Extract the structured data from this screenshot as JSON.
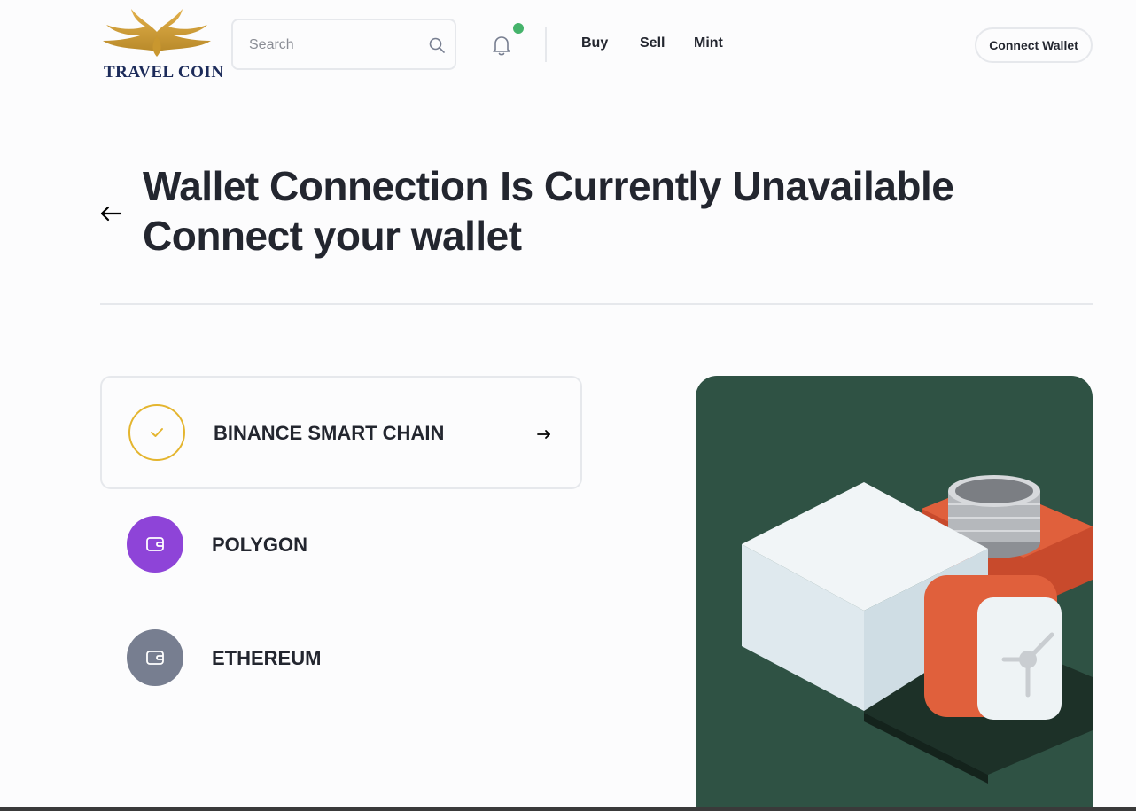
{
  "header": {
    "logo_text": "TRAVEL COIN",
    "search_placeholder": "Search",
    "nav": [
      "Buy",
      "Sell",
      "Mint"
    ],
    "connect_wallet": "Connect Wallet",
    "notification_dot_color": "#45b36b"
  },
  "page": {
    "title_line1": "Wallet Connection Is Currently Unavailable",
    "title_line2": "Connect your wallet"
  },
  "chains": [
    {
      "label": "BINANCE SMART CHAIN",
      "icon": "check-icon",
      "color": "#e4b52f",
      "active": true
    },
    {
      "label": "POLYGON",
      "icon": "wallet-icon",
      "color": "#8e44d8",
      "active": false
    },
    {
      "label": "ETHEREUM",
      "icon": "wallet-icon",
      "color": "#777e90",
      "active": false
    }
  ],
  "colors": {
    "background": "#fcfcfd",
    "text": "#23262f",
    "border": "#e6e8ec",
    "illustration_bg": "#2f5244",
    "accent_orange": "#e0603c"
  }
}
